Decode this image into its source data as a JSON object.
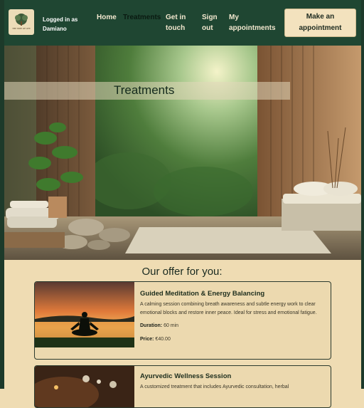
{
  "header": {
    "logo_text": "THE TREE OF LIFE",
    "login_prefix": "Logged in as",
    "username": "Damiano",
    "nav": [
      {
        "label": "Home"
      },
      {
        "label": "Treatments"
      },
      {
        "label": "Get in touch"
      },
      {
        "label": "Sign out"
      },
      {
        "label": "My appointments"
      }
    ],
    "appointment_button": "Make an appointment"
  },
  "hero": {
    "title": "Treatments"
  },
  "offer": {
    "heading": "Our offer for you:",
    "cards": [
      {
        "title": "Guided Meditation & Energy Balancing",
        "description": "A calming session combining breath awareness and subtle energy work to clear emotional blocks and restore inner peace. Ideal for stress and emotional fatigue.",
        "duration_label": "Duration:",
        "duration": "60 min",
        "price_label": "Price:",
        "price": "€40.00"
      },
      {
        "title": "Ayurvedic Wellness Session",
        "description": "A customized treatment that includes Ayurvedic consultation, herbal"
      }
    ]
  },
  "colors": {
    "nav_bg": "#1f4632",
    "page_bg": "#efdcb3",
    "accent_button": "#f3e2be"
  }
}
